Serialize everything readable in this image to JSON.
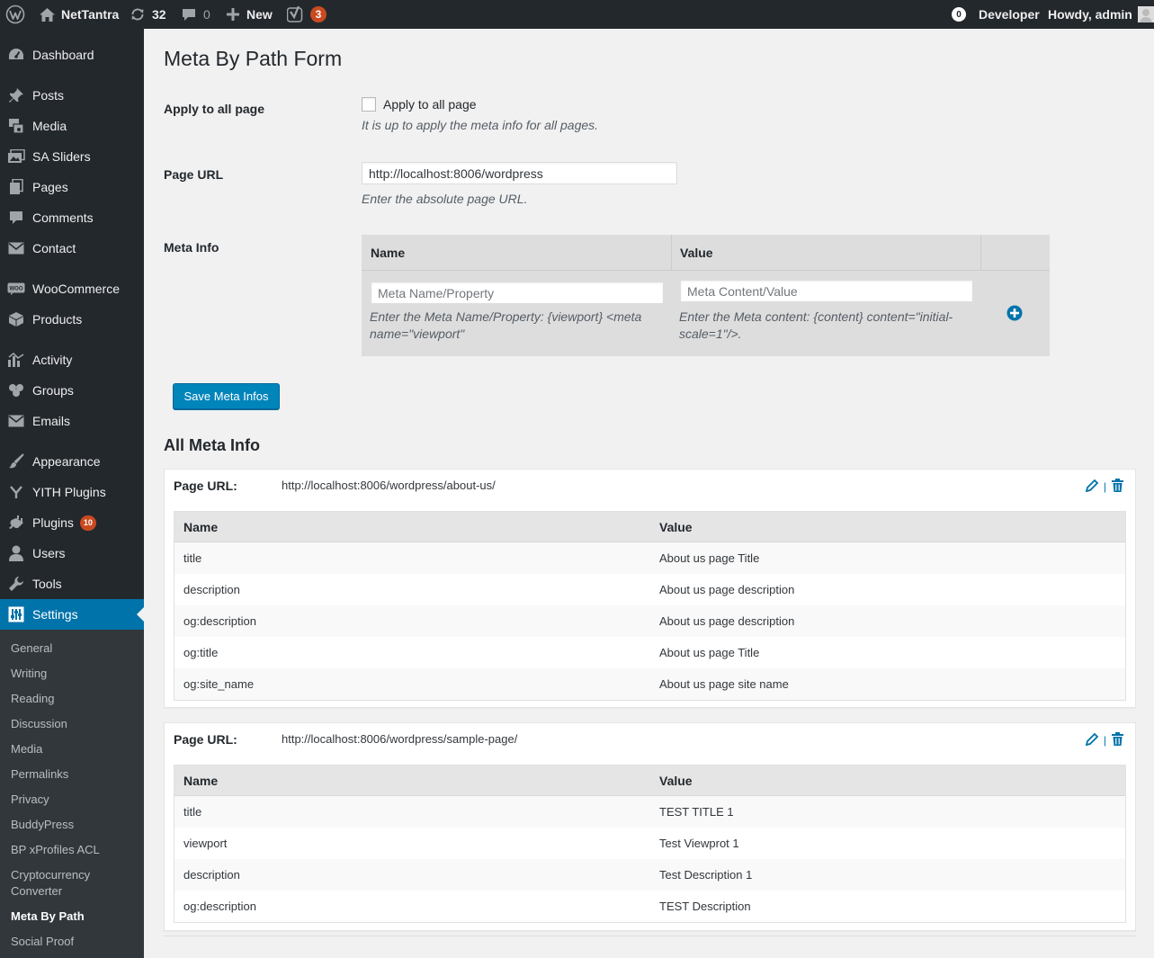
{
  "adminbar": {
    "site_name": "NetTantra",
    "updates_count": "32",
    "comments_count": "0",
    "new_label": "New",
    "yoast_badge": "3",
    "developer_count": "0",
    "developer_label": "Developer",
    "howdy": "Howdy, admin"
  },
  "sidebar": {
    "items": {
      "dashboard": "Dashboard",
      "posts": "Posts",
      "media": "Media",
      "sa_sliders": "SA Sliders",
      "pages": "Pages",
      "comments": "Comments",
      "contact": "Contact",
      "woocommerce": "WooCommerce",
      "products": "Products",
      "activity": "Activity",
      "groups": "Groups",
      "emails": "Emails",
      "appearance": "Appearance",
      "yith_plugins": "YITH Plugins",
      "plugins": "Plugins",
      "plugins_badge": "10",
      "users": "Users",
      "tools": "Tools",
      "settings": "Settings"
    },
    "woo_icon_text": "WOO",
    "submenu": {
      "general": "General",
      "writing": "Writing",
      "reading": "Reading",
      "discussion": "Discussion",
      "media": "Media",
      "permalinks": "Permalinks",
      "privacy": "Privacy",
      "buddypress": "BuddyPress",
      "bp_xprofiles_acl": "BP xProfiles ACL",
      "cryptocurrency_converter": "Cryptocurrency Converter",
      "meta_by_path": "Meta By Path",
      "social_proof": "Social Proof"
    }
  },
  "form": {
    "title": "Meta By Path Form",
    "apply_all": {
      "label": "Apply to all page",
      "checkbox_label": "Apply to all page",
      "description": "It is up to apply the meta info for all pages.",
      "checked": false
    },
    "page_url": {
      "label": "Page URL",
      "value": "http://localhost:8006/wordpress",
      "description": "Enter the absolute page URL."
    },
    "meta_info": {
      "label": "Meta Info",
      "col_name": "Name",
      "col_value": "Value",
      "name_placeholder": "Meta Name/Property",
      "value_placeholder": "Meta Content/Value",
      "name_hint": "Enter the Meta Name/Property: {viewport} <meta name=\"viewport\"",
      "value_hint": "Enter the Meta content: {content} content=\"initial-scale=1\"/>."
    },
    "save_button": "Save Meta Infos"
  },
  "all_meta": {
    "title": "All Meta Info",
    "page_url_label": "Page URL:",
    "col_name": "Name",
    "col_value": "Value",
    "boxes": [
      {
        "url": "http://localhost:8006/wordpress/about-us/",
        "rows": [
          {
            "name": "title",
            "value": "About us page Title"
          },
          {
            "name": "description",
            "value": "About us page description"
          },
          {
            "name": "og:description",
            "value": "About us page description"
          },
          {
            "name": "og:title",
            "value": "About us page Title"
          },
          {
            "name": "og:site_name",
            "value": "About us page site name"
          }
        ]
      },
      {
        "url": "http://localhost:8006/wordpress/sample-page/",
        "rows": [
          {
            "name": "title",
            "value": "TEST TITLE 1"
          },
          {
            "name": "viewport",
            "value": "Test Viewprot 1"
          },
          {
            "name": "description",
            "value": "Test Description 1"
          },
          {
            "name": "og:description",
            "value": "TEST Description"
          }
        ]
      }
    ]
  },
  "colors": {
    "admin_bg": "#23282d",
    "submenu_bg": "#32373c",
    "accent": "#0073aa",
    "button": "#0085ba",
    "badge": "#ca4a1f"
  }
}
